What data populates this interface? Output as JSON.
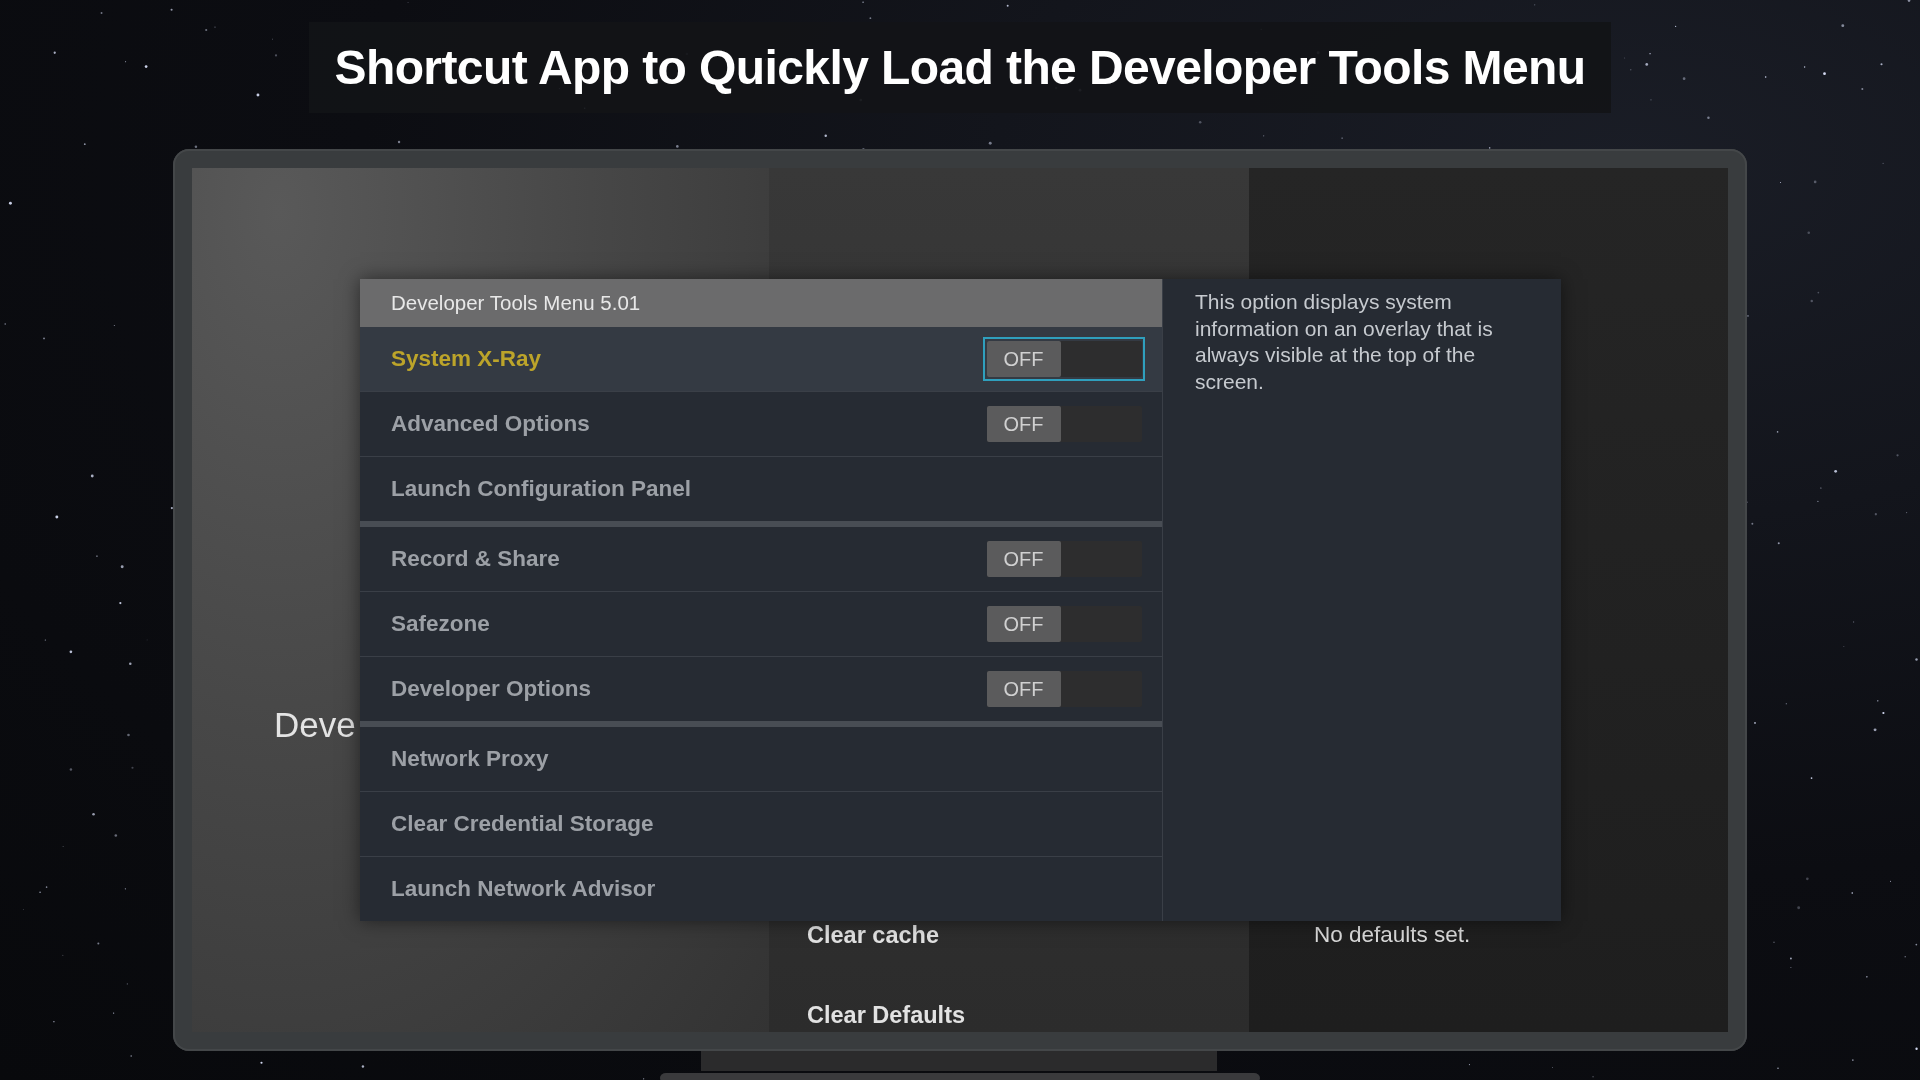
{
  "banner": {
    "title": "Shortcut App to Quickly Load the Developer Tools Menu"
  },
  "screen": {
    "background": {
      "heading": "Deve",
      "actions": [
        "Clear cache",
        "Clear Defaults"
      ],
      "note": "No defaults set."
    },
    "dialog": {
      "title": "Developer Tools Menu 5.01",
      "sections": [
        {
          "items": [
            {
              "kind": "toggle",
              "label": "System X-Ray",
              "selected": true,
              "switch": {
                "text": "OFF",
                "on": false
              }
            },
            {
              "kind": "toggle",
              "label": "Advanced Options",
              "selected": false,
              "switch": {
                "text": "OFF",
                "on": false
              }
            },
            {
              "kind": "action",
              "label": "Launch Configuration Panel",
              "selected": false
            }
          ]
        },
        {
          "items": [
            {
              "kind": "toggle",
              "label": "Record & Share",
              "selected": false,
              "switch": {
                "text": "OFF",
                "on": false
              }
            },
            {
              "kind": "toggle",
              "label": "Safezone",
              "selected": false,
              "switch": {
                "text": "OFF",
                "on": false
              }
            },
            {
              "kind": "toggle",
              "label": "Developer Options",
              "selected": false,
              "switch": {
                "text": "OFF",
                "on": false
              }
            }
          ]
        },
        {
          "items": [
            {
              "kind": "action",
              "label": "Network Proxy",
              "selected": false
            },
            {
              "kind": "action",
              "label": "Clear Credential Storage",
              "selected": false
            },
            {
              "kind": "action",
              "label": "Launch Network Advisor",
              "selected": false
            }
          ]
        }
      ],
      "description": "This option displays system information on an overlay that is always visible at the top of the screen."
    }
  }
}
